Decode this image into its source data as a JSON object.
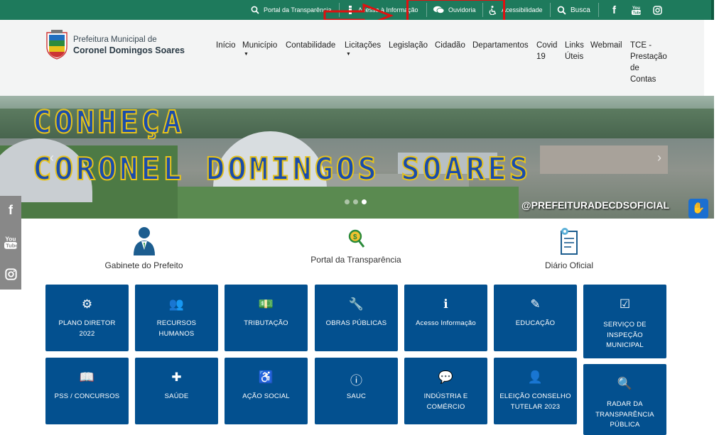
{
  "topbar": {
    "items": [
      {
        "icon": "search-icon",
        "label": "Portal da Transparência"
      },
      {
        "icon": "info-icon",
        "label": "Acesso à Informação"
      },
      {
        "icon": "chat-icon",
        "label": "Ouvidoria"
      },
      {
        "icon": "accessibility-icon",
        "label": "Acessibilidade"
      },
      {
        "icon": "search-icon",
        "label": "Busca"
      }
    ],
    "social": [
      "facebook-icon",
      "youtube-icon",
      "instagram-icon"
    ],
    "color": "#1e7a5c"
  },
  "brand": {
    "line1": "Prefeitura Municipal de",
    "line2": "Coronel Domingos Soares"
  },
  "nav": [
    {
      "label": "Início",
      "lines": [
        "Início"
      ],
      "caret": false
    },
    {
      "label": "Município",
      "lines": [
        "Município"
      ],
      "caret": true
    },
    {
      "label": "Contabilidade",
      "lines": [
        "Contabilidade"
      ],
      "caret": false
    },
    {
      "label": "Licitações",
      "lines": [
        "Licitações"
      ],
      "caret": true
    },
    {
      "label": "Legislação",
      "lines": [
        "Legislação"
      ],
      "caret": false
    },
    {
      "label": "Cidadão",
      "lines": [
        "Cidadão"
      ],
      "caret": false
    },
    {
      "label": "Departamentos",
      "lines": [
        "Departamentos"
      ],
      "caret": false
    },
    {
      "label": "Covid 19",
      "lines": [
        "Covid",
        "19"
      ],
      "caret": false
    },
    {
      "label": "Links Úteis",
      "lines": [
        "Links",
        "Úteis"
      ],
      "caret": false
    },
    {
      "label": "Webmail",
      "lines": [
        "Webmail"
      ],
      "caret": false
    },
    {
      "label": "TCE - Prestação de Contas",
      "lines": [
        "TCE -",
        "Prestação",
        "de",
        "Contas"
      ],
      "caret": false
    }
  ],
  "banner": {
    "line1": "CONHEÇA",
    "line2": "CORONEL DOMINGOS SOARES",
    "handle": "@PREFEITURADECDSOFICIAL"
  },
  "quick_links": [
    {
      "icon": "person-icon",
      "label": "Gabinete do Prefeito"
    },
    {
      "icon": "magnifier-coin-icon",
      "label": "Portal da Transparência"
    },
    {
      "icon": "document-icon",
      "label": "Diário Oficial"
    }
  ],
  "tiles": [
    {
      "icon": "gears-icon",
      "glyph": "⚙",
      "label": "PLANO DIRETOR 2022"
    },
    {
      "icon": "users-icon",
      "glyph": "👥",
      "label": "RECURSOS HUMANOS"
    },
    {
      "icon": "money-icon",
      "glyph": "💵",
      "label": "TRIBUTAÇÃO"
    },
    {
      "icon": "wrench-icon",
      "glyph": "🔧",
      "label": "OBRAS PÚBLICAS"
    },
    {
      "icon": "info-icon",
      "glyph": "ℹ",
      "label": "Acesso Informação"
    },
    {
      "icon": "pencil-icon",
      "glyph": "✎",
      "label": "EDUCAÇÃO"
    },
    {
      "icon": "checkbox-icon",
      "glyph": "☑",
      "label": "SERVIÇO DE INSPEÇÃO MUNICIPAL"
    },
    {
      "icon": "book-icon",
      "glyph": "📖",
      "label": "PSS / CONCURSOS"
    },
    {
      "icon": "medkit-icon",
      "glyph": "✚",
      "label": "SAÚDE"
    },
    {
      "icon": "wheelchair-icon",
      "glyph": "♿",
      "label": "AÇÃO SOCIAL"
    },
    {
      "icon": "info-circle-icon",
      "glyph": "ⓘ",
      "label": "SAUC"
    },
    {
      "icon": "chat-icon",
      "glyph": "💬",
      "label": "INDÚSTRIA E COMÉRCIO"
    },
    {
      "icon": "user-icon",
      "glyph": "👤",
      "label": "ELEIÇÃO CONSELHO TUTELAR 2023"
    },
    {
      "icon": "zoom-in-icon",
      "glyph": "🔍",
      "label": "RADAR DA TRANSPARÊNCIA PÚBLICA"
    }
  ],
  "colors": {
    "tile": "#03508f",
    "annotation": "#e01010",
    "banner_text": "#1a4cab",
    "banner_outline": "#e6c21b"
  }
}
